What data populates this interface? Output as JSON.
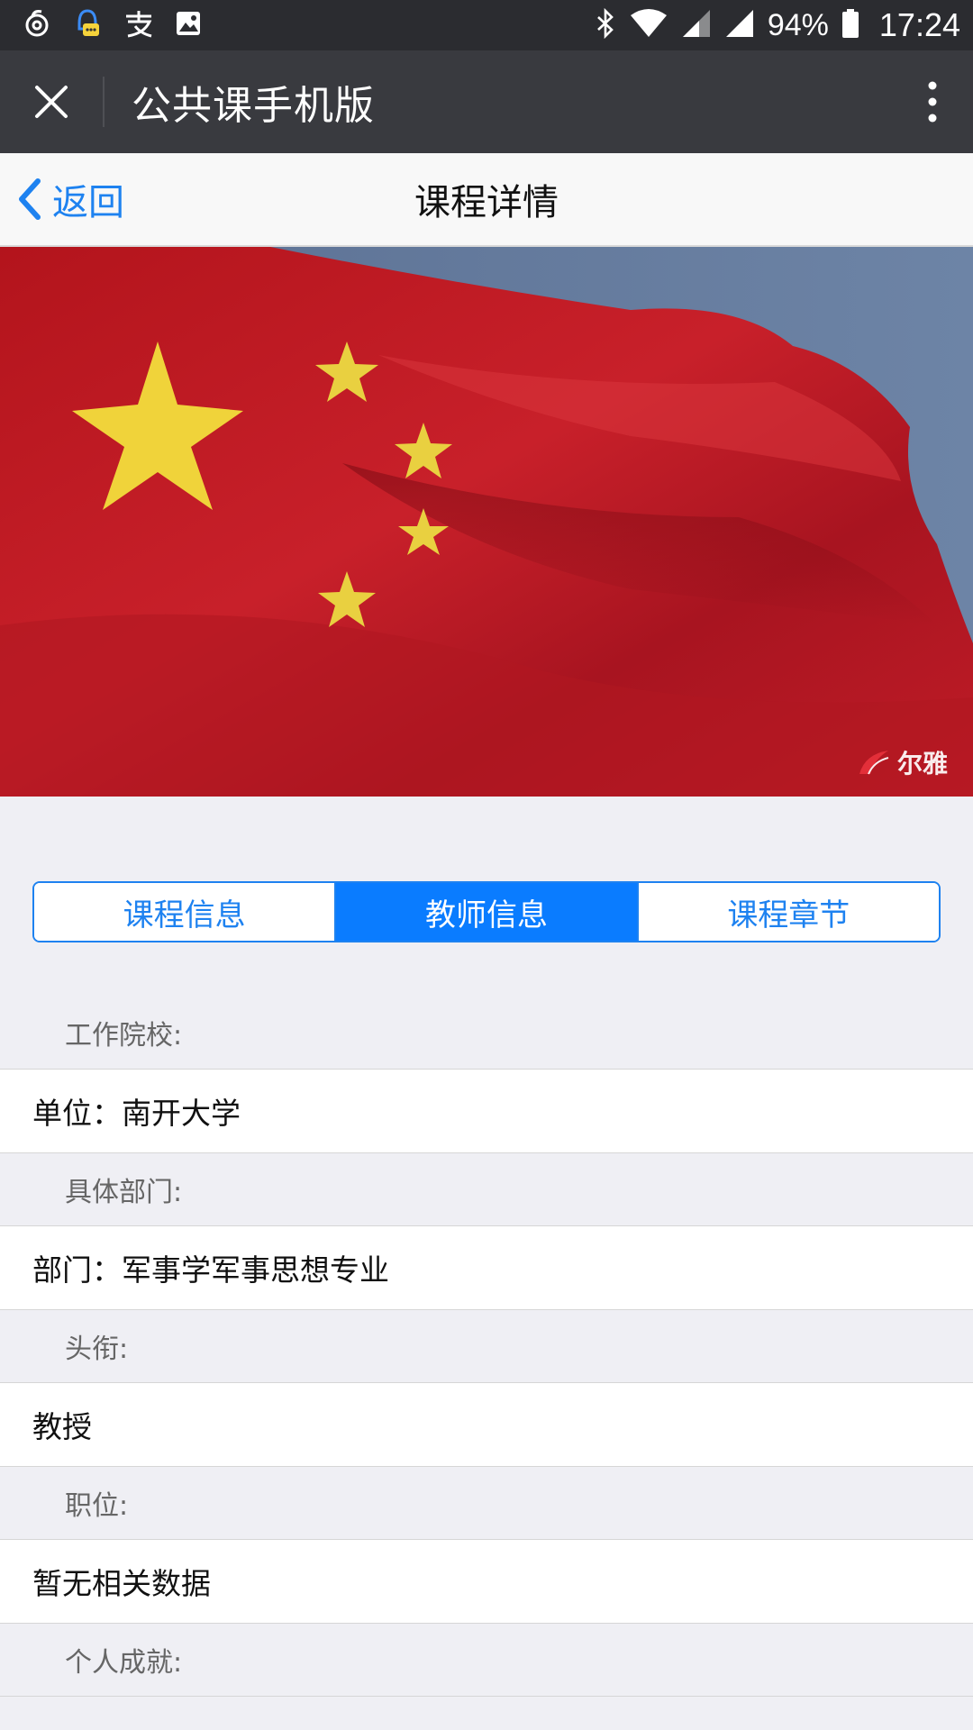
{
  "status_bar": {
    "battery": "94%",
    "time": "17:24",
    "left_icons": [
      "netease-music-icon",
      "qq-icon",
      "alipay-icon",
      "gallery-icon"
    ],
    "right_icons": [
      "bluetooth-icon",
      "wifi-icon",
      "signal-icon",
      "signal-icon",
      "battery-icon"
    ]
  },
  "topbar": {
    "title": "公共课手机版"
  },
  "navbar": {
    "back_label": "返回",
    "title": "课程详情"
  },
  "cover": {
    "watermark_text": "尔雅"
  },
  "tabs": [
    {
      "label": "课程信息",
      "active": false
    },
    {
      "label": "教师信息",
      "active": true
    },
    {
      "label": "课程章节",
      "active": false
    }
  ],
  "teacher_info": {
    "school_label": "工作院校:",
    "school_value": "单位：南开大学",
    "dept_label": "具体部门:",
    "dept_value": "部门：军事学军事思想专业",
    "title_label": "头衔:",
    "title_value": "教授",
    "position_label": "职位:",
    "position_value": "暂无相关数据",
    "achievement_label": "个人成就:"
  },
  "colors": {
    "accent": "#0a7cff",
    "link": "#1e82f0",
    "topbar_bg": "#393a3f",
    "statusbar_bg": "#2b2c30",
    "page_bg": "#efeff4"
  }
}
